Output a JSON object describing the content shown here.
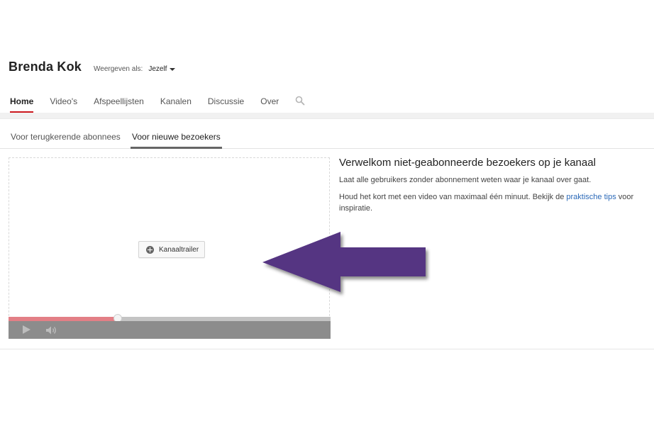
{
  "channel": {
    "name": "Brenda Kok",
    "view_as_label": "Weergeven als:",
    "view_as_value": "Jezelf"
  },
  "nav": {
    "tabs": [
      {
        "label": "Home",
        "active": true
      },
      {
        "label": "Video's"
      },
      {
        "label": "Afspeellijsten"
      },
      {
        "label": "Kanalen"
      },
      {
        "label": "Discussie"
      },
      {
        "label": "Over"
      }
    ],
    "search_icon": "search-icon",
    "active_color": "#cc181e"
  },
  "sub_tabs": [
    {
      "label": "Voor terugkerende abonnees"
    },
    {
      "label": "Voor nieuwe bezoekers",
      "active": true
    }
  ],
  "trailer": {
    "button_label": "Kanaaltrailer",
    "button_icon": "plus-circle-icon",
    "progress_fraction": 0.34,
    "progress_color": "#e37f86",
    "play_icon": "play-icon",
    "volume_icon": "volume-icon"
  },
  "welcome": {
    "title": "Verwelkom niet-geabonneerde bezoekers op je kanaal",
    "line1": "Laat alle gebruikers zonder abonnement weten waar je kanaal over gaat.",
    "line2_prefix": "Houd het kort met een video van maximaal één minuut. Bekijk de ",
    "line2_link": "praktische tips",
    "line2_suffix": " voor inspiratie.",
    "link_color": "#2b69b8"
  },
  "annotation": {
    "arrow_icon": "left-arrow-icon",
    "arrow_color": "#553582"
  }
}
